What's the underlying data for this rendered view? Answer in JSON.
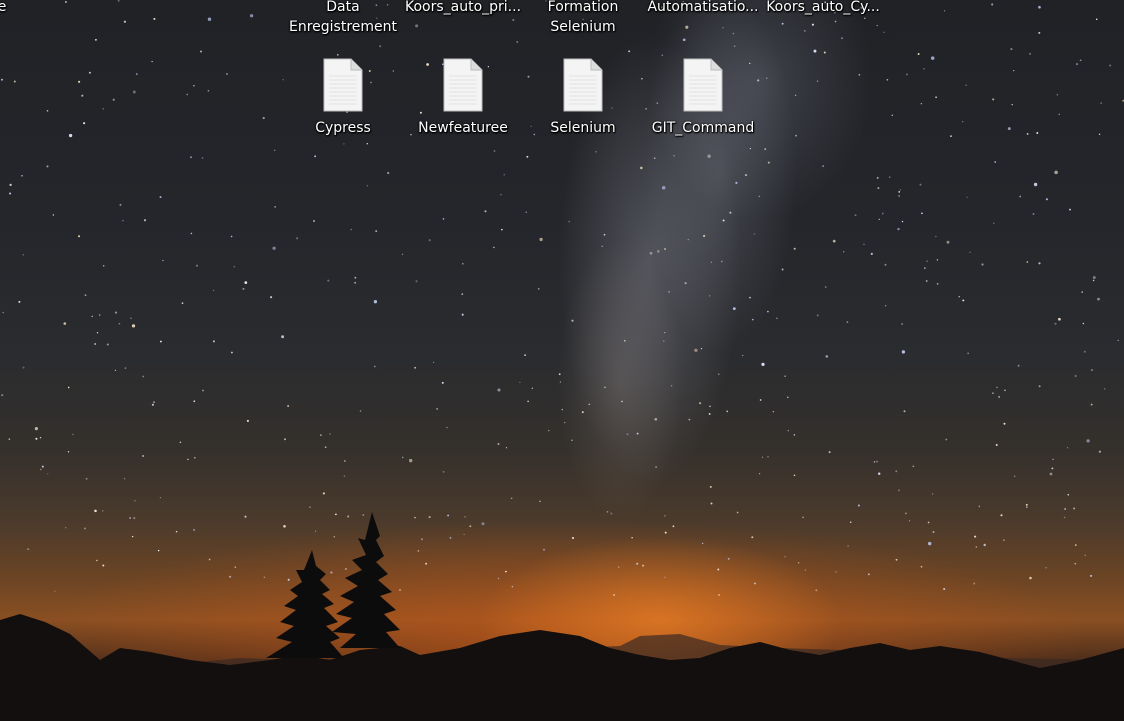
{
  "desktop": {
    "top_row": [
      {
        "lines": [
          "e"
        ]
      },
      {
        "lines": [
          "Data",
          "Enregistrement"
        ]
      },
      {
        "lines": [
          "Koors_auto_pri..."
        ]
      },
      {
        "lines": [
          "Formation",
          "Selenium"
        ]
      },
      {
        "lines": [
          "Automatisatio..."
        ]
      },
      {
        "lines": [
          "Koors_auto_Cy..."
        ]
      }
    ],
    "icons": [
      {
        "label": "Cypress",
        "icon": "document-file-icon"
      },
      {
        "label": "Newfeaturee",
        "icon": "document-file-icon"
      },
      {
        "label": "Selenium",
        "icon": "document-file-icon"
      },
      {
        "label": "GIT_Command",
        "icon": "document-file-icon"
      }
    ]
  }
}
